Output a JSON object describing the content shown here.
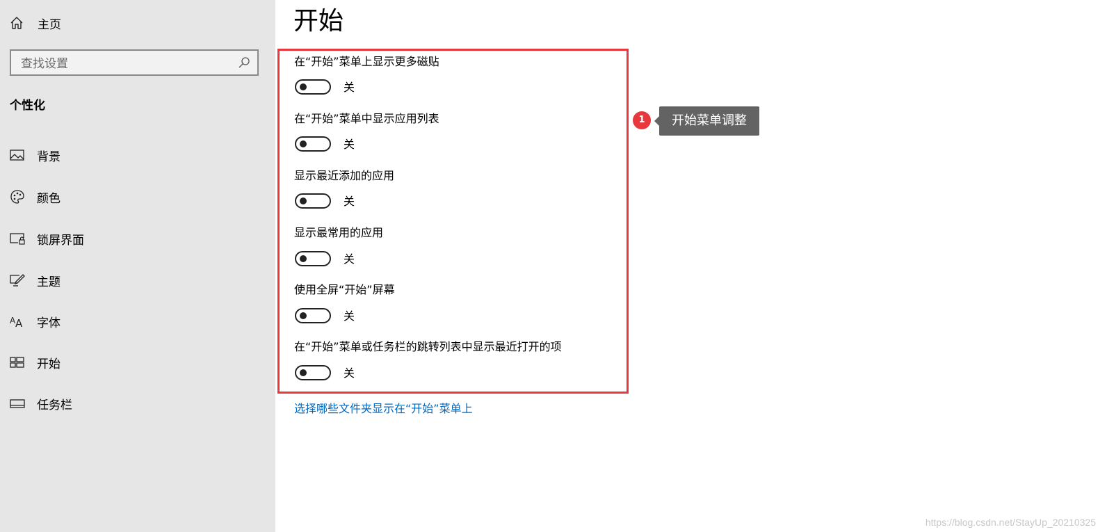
{
  "sidebar": {
    "home_label": "主页",
    "search_placeholder": "查找设置",
    "section_title": "个性化",
    "items": [
      {
        "label": "背景",
        "icon": "image-icon"
      },
      {
        "label": "颜色",
        "icon": "palette-icon"
      },
      {
        "label": "锁屏界面",
        "icon": "lock-screen-icon"
      },
      {
        "label": "主题",
        "icon": "theme-icon"
      },
      {
        "label": "字体",
        "icon": "font-icon"
      },
      {
        "label": "开始",
        "icon": "start-icon"
      },
      {
        "label": "任务栏",
        "icon": "taskbar-icon"
      }
    ]
  },
  "main": {
    "title": "开始",
    "settings": [
      {
        "label": "在“开始”菜单上显示更多磁贴",
        "state": "关"
      },
      {
        "label": "在“开始”菜单中显示应用列表",
        "state": "关"
      },
      {
        "label": "显示最近添加的应用",
        "state": "关"
      },
      {
        "label": "显示最常用的应用",
        "state": "关"
      },
      {
        "label": "使用全屏“开始”屏幕",
        "state": "关"
      },
      {
        "label": "在“开始”菜单或任务栏的跳转列表中显示最近打开的项",
        "state": "关"
      }
    ],
    "link_text": "选择哪些文件夹显示在“开始”菜单上"
  },
  "annotation": {
    "badge_number": "1",
    "callout_text": "开始菜单调整"
  },
  "watermark": "https://blog.csdn.net/StayUp_20210325",
  "colors": {
    "sidebar_bg": "#e6e6e6",
    "highlight_border": "#e8373d",
    "link": "#0067c0",
    "callout_bg": "#636363"
  }
}
